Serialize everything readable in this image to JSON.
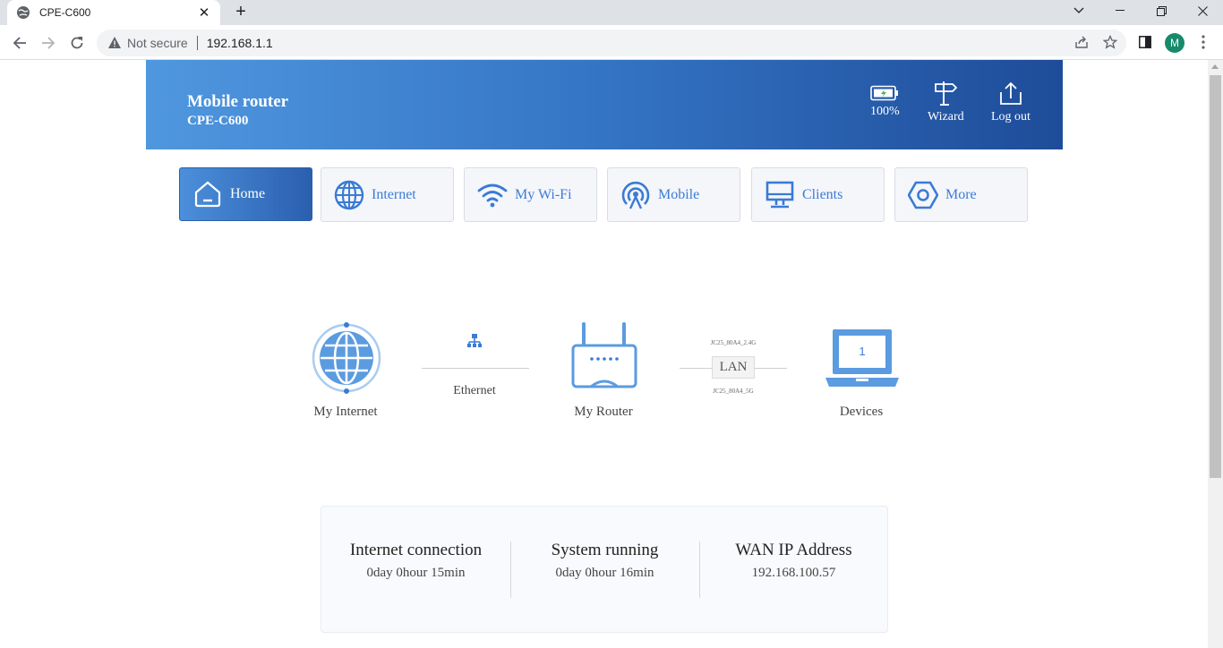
{
  "browser": {
    "tab_title": "CPE-C600",
    "security_label": "Not secure",
    "url": "192.168.1.1",
    "profile_initial": "M"
  },
  "header": {
    "title": "Mobile router",
    "model": "CPE-C600",
    "battery_label": "100%",
    "wizard_label": "Wizard",
    "logout_label": "Log out"
  },
  "nav": {
    "tabs": [
      {
        "label": "Home",
        "icon": "home-icon",
        "active": true
      },
      {
        "label": "Internet",
        "icon": "globe-icon"
      },
      {
        "label": "My Wi-Fi",
        "icon": "wifi-icon"
      },
      {
        "label": "Mobile",
        "icon": "antenna-icon"
      },
      {
        "label": "Clients",
        "icon": "monitor-icon"
      },
      {
        "label": "More",
        "icon": "hexagon-icon"
      }
    ]
  },
  "topology": {
    "internet_label": "My Internet",
    "ethernet_label": "Ethernet",
    "router_label": "My Router",
    "ssid_24": "JC25_80A4_2.4G",
    "lan_label": "LAN",
    "ssid_5": "JC25_80A4_5G",
    "devices_count": "1",
    "devices_label": "Devices"
  },
  "status": {
    "items": [
      {
        "title": "Internet connection",
        "value": "0day 0hour 15min"
      },
      {
        "title": "System running",
        "value": "0day 0hour 16min"
      },
      {
        "title": "WAN IP Address",
        "value": "192.168.100.57"
      }
    ]
  },
  "colors": {
    "accent": "#3a7bd5",
    "header_start": "#4f97df",
    "header_end": "#1e4c99",
    "battery_charge": "#4caf50"
  }
}
